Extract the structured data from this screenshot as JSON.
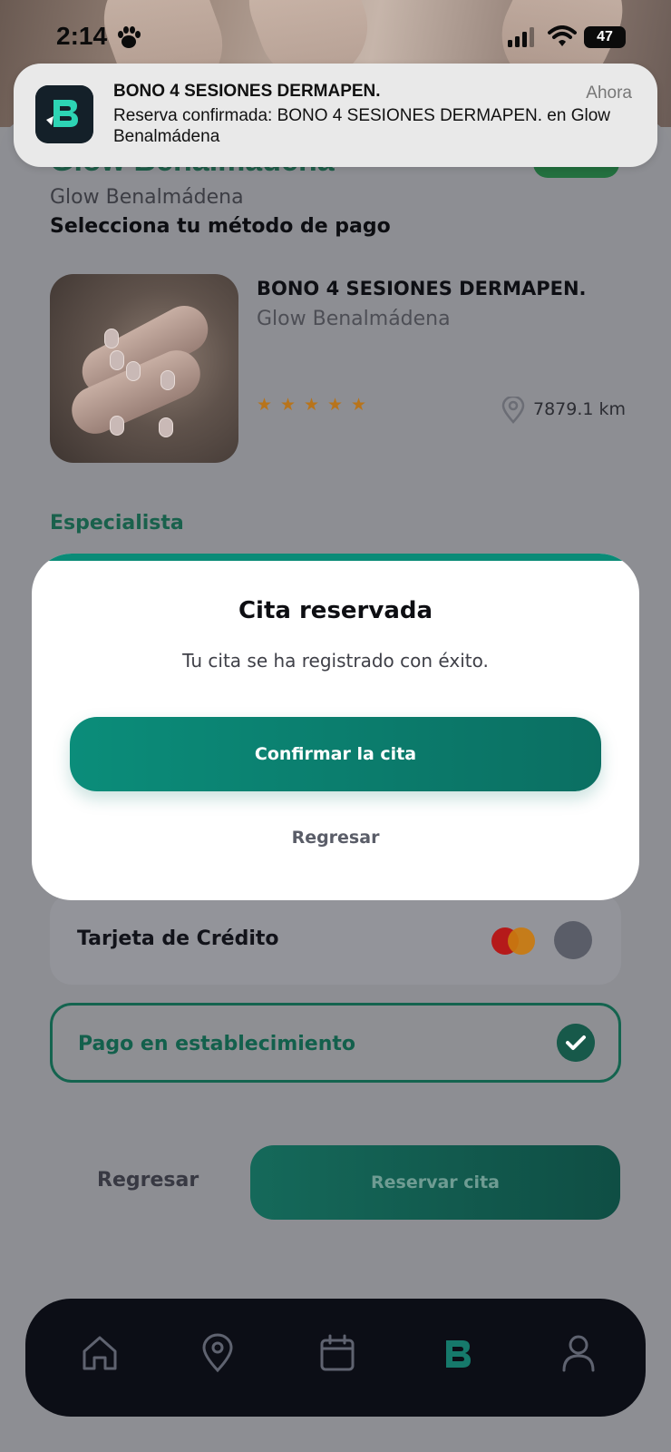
{
  "status_bar": {
    "time": "2:14",
    "battery": "47"
  },
  "notification": {
    "title": "BONO 4 SESIONES DERMAPEN.",
    "time": "Ahora",
    "body": "Reserva confirmada: BONO 4 SESIONES DERMAPEN. en Glow Benalmádena",
    "app_icon": "brand-b-icon"
  },
  "shop": {
    "title": "Glow Benalmádena",
    "subtitle": "Glow Benalmádena",
    "payment_heading": "Selecciona tu método de pago"
  },
  "service": {
    "name": "BONO 4 SESIONES DERMAPEN.",
    "location": "Glow Benalmádena",
    "rating": 5,
    "distance": "7879.1 km"
  },
  "specialist_section": "Especialista",
  "payment_options": [
    {
      "label": "Tarjeta de Crédito",
      "selected": false
    },
    {
      "label": "Pago en establecimiento",
      "selected": true
    }
  ],
  "footer": {
    "back_label": "Regresar",
    "reserve_label": "Reservar cita"
  },
  "modal": {
    "title": "Cita reservada",
    "message": "Tu cita se ha registrado con éxito.",
    "confirm_label": "Confirmar la cita",
    "back_label": "Regresar"
  },
  "bottom_nav": [
    {
      "icon": "home-icon"
    },
    {
      "icon": "map-pin-icon"
    },
    {
      "icon": "calendar-icon"
    },
    {
      "icon": "brand-b-icon"
    },
    {
      "icon": "user-icon"
    }
  ],
  "colors": {
    "brand": "#0a8b77",
    "dark": "#0c0e16",
    "star": "#b8741b"
  }
}
